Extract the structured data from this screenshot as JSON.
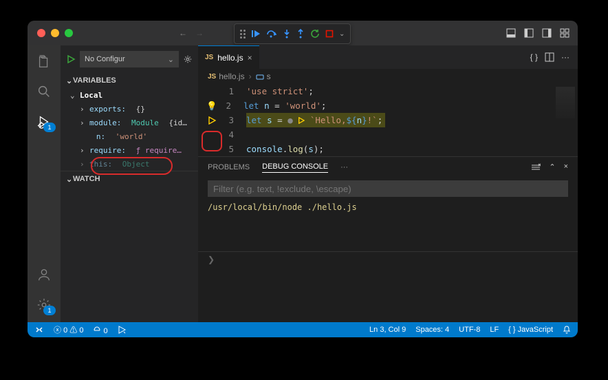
{
  "debug_toolbar": {
    "badge_run": "1",
    "badge_gear": "1"
  },
  "sidebar": {
    "config_label": "No Configur",
    "sections": {
      "variables": "VARIABLES",
      "watch": "WATCH"
    },
    "local_label": "Local",
    "vars": {
      "exports": {
        "name": "exports:",
        "value": "{}"
      },
      "module": {
        "name": "module:",
        "type": "Module",
        "suffix": "{id…"
      },
      "n": {
        "name": "n:",
        "value": "'world'"
      },
      "require": {
        "name": "require:",
        "value": "ƒ require…"
      },
      "this": {
        "name": "this:",
        "type": "Object"
      }
    }
  },
  "editor": {
    "tab_filename": "hello.js",
    "breadcrumb": {
      "file": "hello.js",
      "symbol": "s"
    },
    "lines": {
      "1": "1",
      "2": "2",
      "3": "3",
      "4": "4",
      "5": "5"
    },
    "code": {
      "let1": "let",
      "n_id": "n",
      "eq": "=",
      "world": "'world'",
      "semi": ";",
      "let2": "let",
      "s_id": "s",
      "tick_open": "`Hello, ",
      "tvar_open": "${",
      "tvar_id": "n",
      "tvar_close": "}",
      "excl": "!`",
      "use_strict": "'use strict'",
      "console": "console",
      "dot": ".",
      "log": "log",
      "open": "(",
      "arg": "s",
      "close": ")"
    }
  },
  "panel": {
    "tabs": {
      "problems": "PROBLEMS",
      "debug": "DEBUG CONSOLE",
      "more": "···"
    },
    "filter_placeholder": "Filter (e.g. text, !exclude, \\escape)",
    "output_line": "/usr/local/bin/node ./hello.js",
    "prompt": "❯"
  },
  "status": {
    "errors": "0",
    "warnings": "0",
    "ports": "0",
    "ln_col": "Ln 3, Col 9",
    "spaces": "Spaces: 4",
    "encoding": "UTF-8",
    "eol": "LF",
    "lang": "JavaScript"
  }
}
